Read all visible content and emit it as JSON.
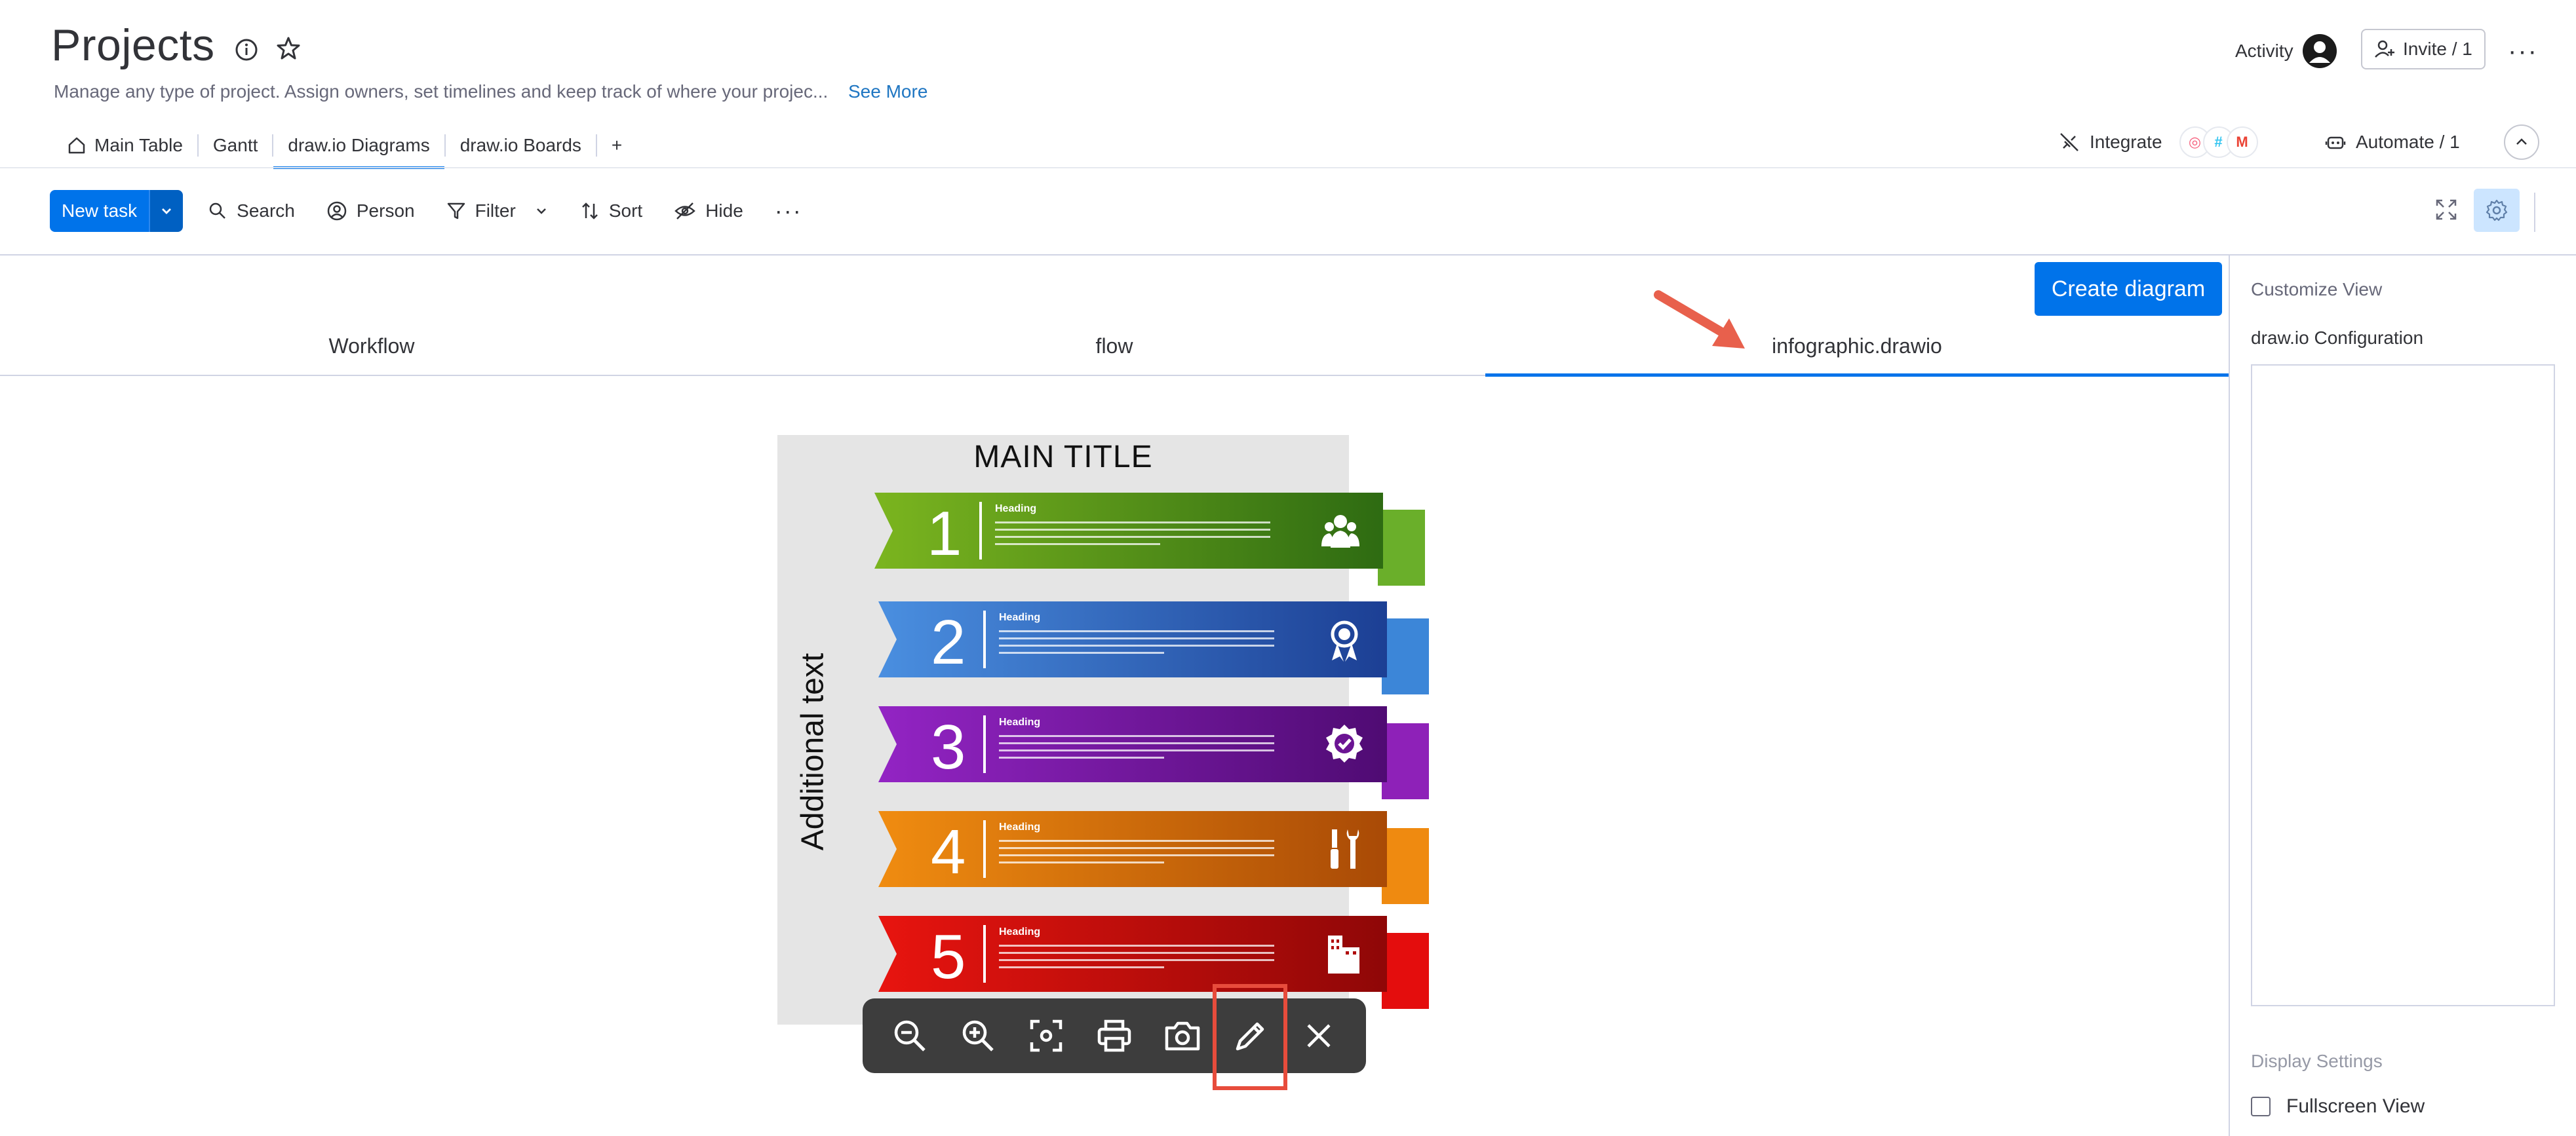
{
  "header": {
    "title": "Projects",
    "description": "Manage any type of project. Assign owners, set timelines and keep track of where your projec...",
    "see_more": "See More",
    "activity_label": "Activity",
    "invite_label": "Invite / 1"
  },
  "view_tabs": [
    {
      "label": "Main Table",
      "icon": "home-icon"
    },
    {
      "label": "Gantt"
    },
    {
      "label": "draw.io Diagrams",
      "active": true
    },
    {
      "label": "draw.io Boards"
    },
    {
      "label": "+"
    }
  ],
  "integrations": {
    "integrate_label": "Integrate",
    "automate_label": "Automate / 1"
  },
  "toolbar": {
    "new_task": "New task",
    "search": "Search",
    "person": "Person",
    "filter": "Filter",
    "sort": "Sort",
    "hide": "Hide"
  },
  "diagram_panel": {
    "create_button": "Create diagram",
    "tabs": [
      "Workflow",
      "flow",
      "infographic.drawio"
    ],
    "active_tab": "infographic.drawio"
  },
  "diagram": {
    "title": "MAIN TITLE",
    "side_text": "Additional text",
    "items": [
      {
        "number": "1",
        "heading": "Heading",
        "color": "#4c9a1c",
        "dark": "#2e6b12",
        "tail": "#6aaf2a",
        "icon": "people-icon"
      },
      {
        "number": "2",
        "heading": "Heading",
        "color": "#2a62c9",
        "dark": "#1c3f94",
        "tail": "#3c86d8",
        "icon": "award-icon"
      },
      {
        "number": "3",
        "heading": "Heading",
        "color": "#7a1aa8",
        "dark": "#4f0b73",
        "tail": "#8e21b8",
        "icon": "badge-check-icon"
      },
      {
        "number": "4",
        "heading": "Heading",
        "color": "#e87c0c",
        "dark": "#a94a06",
        "tail": "#ef8a10",
        "icon": "tools-icon"
      },
      {
        "number": "5",
        "heading": "Heading",
        "color": "#d40e0e",
        "dark": "#8f0707",
        "tail": "#e40d0d",
        "icon": "building-icon"
      }
    ]
  },
  "right_panel": {
    "customize_view": "Customize View",
    "config_label": "draw.io Configuration",
    "display_settings": "Display Settings",
    "fullscreen_label": "Fullscreen View"
  }
}
